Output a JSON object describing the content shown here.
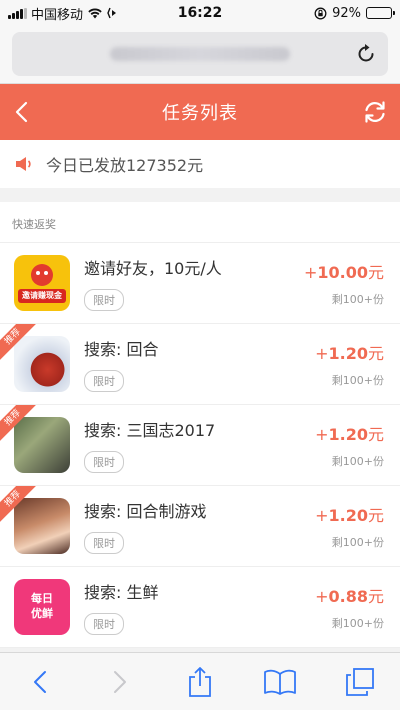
{
  "status": {
    "carrier": "中国移动",
    "time": "16:22",
    "battery": "92%",
    "battery_level": 0.92
  },
  "header": {
    "title": "任务列表"
  },
  "notice": {
    "text": "今日已发放127352元"
  },
  "section": {
    "label": "快速返奖"
  },
  "badge_text": "推荐",
  "tasks": [
    {
      "title": "邀请好友，10元/人",
      "tag": "限时",
      "reward_sign": "+",
      "reward_amount": "10.00",
      "reward_unit": "元",
      "remaining": "剩100+份",
      "recommended": false,
      "icon_text": "邀请赚现金"
    },
    {
      "title": "搜索: 回合",
      "tag": "限时",
      "reward_sign": "+",
      "reward_amount": "1.20",
      "reward_unit": "元",
      "remaining": "剩100+份",
      "recommended": true
    },
    {
      "title": "搜索: 三国志2017",
      "tag": "限时",
      "reward_sign": "+",
      "reward_amount": "1.20",
      "reward_unit": "元",
      "remaining": "剩100+份",
      "recommended": true
    },
    {
      "title": "搜索: 回合制游戏",
      "tag": "限时",
      "reward_sign": "+",
      "reward_amount": "1.20",
      "reward_unit": "元",
      "remaining": "剩100+份",
      "recommended": true
    },
    {
      "title": "搜索: 生鲜",
      "tag": "限时",
      "reward_sign": "+",
      "reward_amount": "0.88",
      "reward_unit": "元",
      "remaining": "剩100+份",
      "recommended": false,
      "icon_text_1": "每日",
      "icon_text_2": "优鲜"
    }
  ],
  "colors": {
    "accent": "#f06a52",
    "ios_blue": "#3478f6"
  }
}
